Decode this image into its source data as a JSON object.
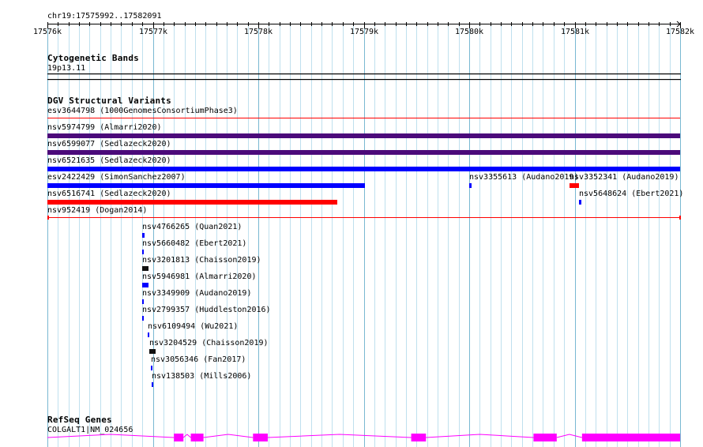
{
  "view": {
    "start": 17576000,
    "end": 17582000
  },
  "region": "chr19:17575992..17582091",
  "ruler": {
    "ticks": [
      {
        "pos": 17576000,
        "label": "17576k"
      },
      {
        "pos": 17577000,
        "label": "17577k"
      },
      {
        "pos": 17578000,
        "label": "17578k"
      },
      {
        "pos": 17579000,
        "label": "17579k"
      },
      {
        "pos": 17580000,
        "label": "17580k"
      },
      {
        "pos": 17581000,
        "label": "17581k"
      },
      {
        "pos": 17582000,
        "label": "17582k"
      }
    ]
  },
  "cytobands": {
    "title": "Cytogenetic Bands",
    "band": "19p13.11"
  },
  "dgv": {
    "title": "DGV Structural Variants",
    "features": [
      {
        "label": "esv3644798 (1000GenomesConsortiumPhase3)",
        "start": 17576000,
        "end": 17582000,
        "row": 0,
        "color": "#ff0000",
        "style": "line"
      },
      {
        "label": "nsv5974799 (Almarri2020)",
        "start": 17576000,
        "end": 17582000,
        "row": 1,
        "color": "#4b0a7a",
        "style": "bar"
      },
      {
        "label": "nsv6599077 (Sedlazeck2020)",
        "start": 17576000,
        "end": 17582000,
        "row": 2,
        "color": "#4b0a7a",
        "style": "bar"
      },
      {
        "label": "nsv6521635 (Sedlazeck2020)",
        "start": 17576000,
        "end": 17582000,
        "row": 3,
        "color": "#0000ff",
        "style": "bar"
      },
      {
        "label": "esv2422429 (SimonSanchez2007)",
        "start": 17576000,
        "end": 17579010,
        "row": 4,
        "color": "#0000ff",
        "style": "bar"
      },
      {
        "label": "nsv3355613 (Audano2019)",
        "start": 17580000,
        "end": 17580020,
        "row": 4,
        "color": "#0000ff",
        "style": "bar"
      },
      {
        "label": "nsv3352341 (Audano2019)",
        "start": 17580950,
        "end": 17581040,
        "row": 4,
        "color": "#ff0000",
        "style": "bar"
      },
      {
        "label": "nsv6516741 (Sedlazeck2020)",
        "start": 17576000,
        "end": 17578750,
        "row": 5,
        "color": "#ff0000",
        "style": "bar"
      },
      {
        "label": "nsv5648624 (Ebert2021)",
        "start": 17581040,
        "end": 17581060,
        "row": 5,
        "color": "#0000ff",
        "style": "bar"
      },
      {
        "label": "nsv952419 (Dogan2014)",
        "start": 17576000,
        "end": 17582000,
        "row": 6,
        "color": "#ff0000",
        "style": "line-capped"
      },
      {
        "label": "nsv4766265 (Quan2021)",
        "start": 17576900,
        "end": 17576920,
        "row": 7,
        "color": "#0000ff",
        "style": "bar"
      },
      {
        "label": "nsv5660482 (Ebert2021)",
        "start": 17576900,
        "end": 17576915,
        "row": 8,
        "color": "#0000ff",
        "style": "bar"
      },
      {
        "label": "nsv3201813 (Chaisson2019)",
        "start": 17576900,
        "end": 17576960,
        "row": 9,
        "color": "#111111",
        "style": "bar"
      },
      {
        "label": "nsv5946981 (Almarri2020)",
        "start": 17576900,
        "end": 17576960,
        "row": 10,
        "color": "#0000ff",
        "style": "bar"
      },
      {
        "label": "nsv3349909 (Audano2019)",
        "start": 17576900,
        "end": 17576915,
        "row": 11,
        "color": "#0000ff",
        "style": "bar"
      },
      {
        "label": "nsv2799357 (Huddleston2016)",
        "start": 17576900,
        "end": 17576915,
        "row": 12,
        "color": "#0000ff",
        "style": "bar"
      },
      {
        "label": "nsv6109494 (Wu2021)",
        "start": 17576950,
        "end": 17576965,
        "row": 13,
        "color": "#0000ff",
        "style": "bar"
      },
      {
        "label": "nsv3204529 (Chaisson2019)",
        "start": 17576970,
        "end": 17577030,
        "row": 14,
        "color": "#111111",
        "style": "bar"
      },
      {
        "label": "nsv3056346 (Fan2017)",
        "start": 17576980,
        "end": 17576995,
        "row": 15,
        "color": "#0000ff",
        "style": "bar"
      },
      {
        "label": "nsv138503 (Mills2006)",
        "start": 17576990,
        "end": 17577005,
        "row": 16,
        "color": "#0000ff",
        "style": "bar"
      }
    ]
  },
  "refseq": {
    "title": "RefSeq Genes",
    "gene": {
      "label": "COLGALT1|NM_024656",
      "start": 17576000,
      "end": 17582000,
      "color": "#ff00ff",
      "exons": [
        {
          "start": 17577200,
          "end": 17577290
        },
        {
          "start": 17577360,
          "end": 17577480
        },
        {
          "start": 17577950,
          "end": 17578090
        },
        {
          "start": 17579450,
          "end": 17579590
        },
        {
          "start": 17580610,
          "end": 17580830
        },
        {
          "start": 17581070,
          "end": 17582000
        }
      ]
    }
  }
}
